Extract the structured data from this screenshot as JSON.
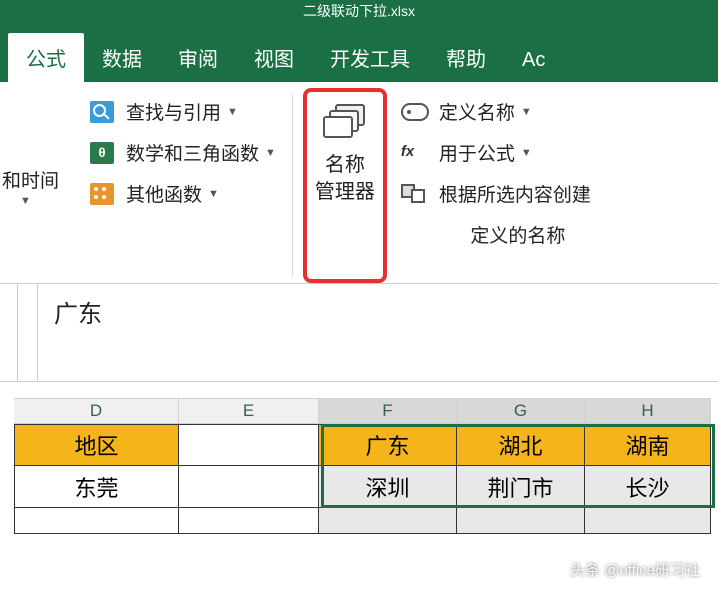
{
  "titlebar": "二级联动下拉.xlsx",
  "tabs": {
    "active": "公式",
    "items": [
      "公式",
      "数据",
      "审阅",
      "视图",
      "开发工具",
      "帮助",
      "Ac"
    ]
  },
  "ribbon": {
    "left_cut": "和时间",
    "group_funcs": {
      "lookup": "查找与引用",
      "math": "数学和三角函数",
      "other": "其他函数"
    },
    "name_manager": "名称\n管理器",
    "defined_names": {
      "define": "定义名称",
      "use_in_formula": "用于公式",
      "create_from_selection": "根据所选内容创建",
      "group_label": "定义的名称"
    }
  },
  "formula_bar": {
    "value": "广东"
  },
  "sheet": {
    "columns": [
      "D",
      "E",
      "F",
      "G",
      "H"
    ],
    "header_row": {
      "D": "地区",
      "E": "",
      "F": "广东",
      "G": "湖北",
      "H": "湖南"
    },
    "data_rows": [
      {
        "D": "东莞",
        "E": "",
        "F": "深圳",
        "G": "荆门市",
        "H": "长沙"
      }
    ]
  },
  "watermark": "头条 @office研习社"
}
